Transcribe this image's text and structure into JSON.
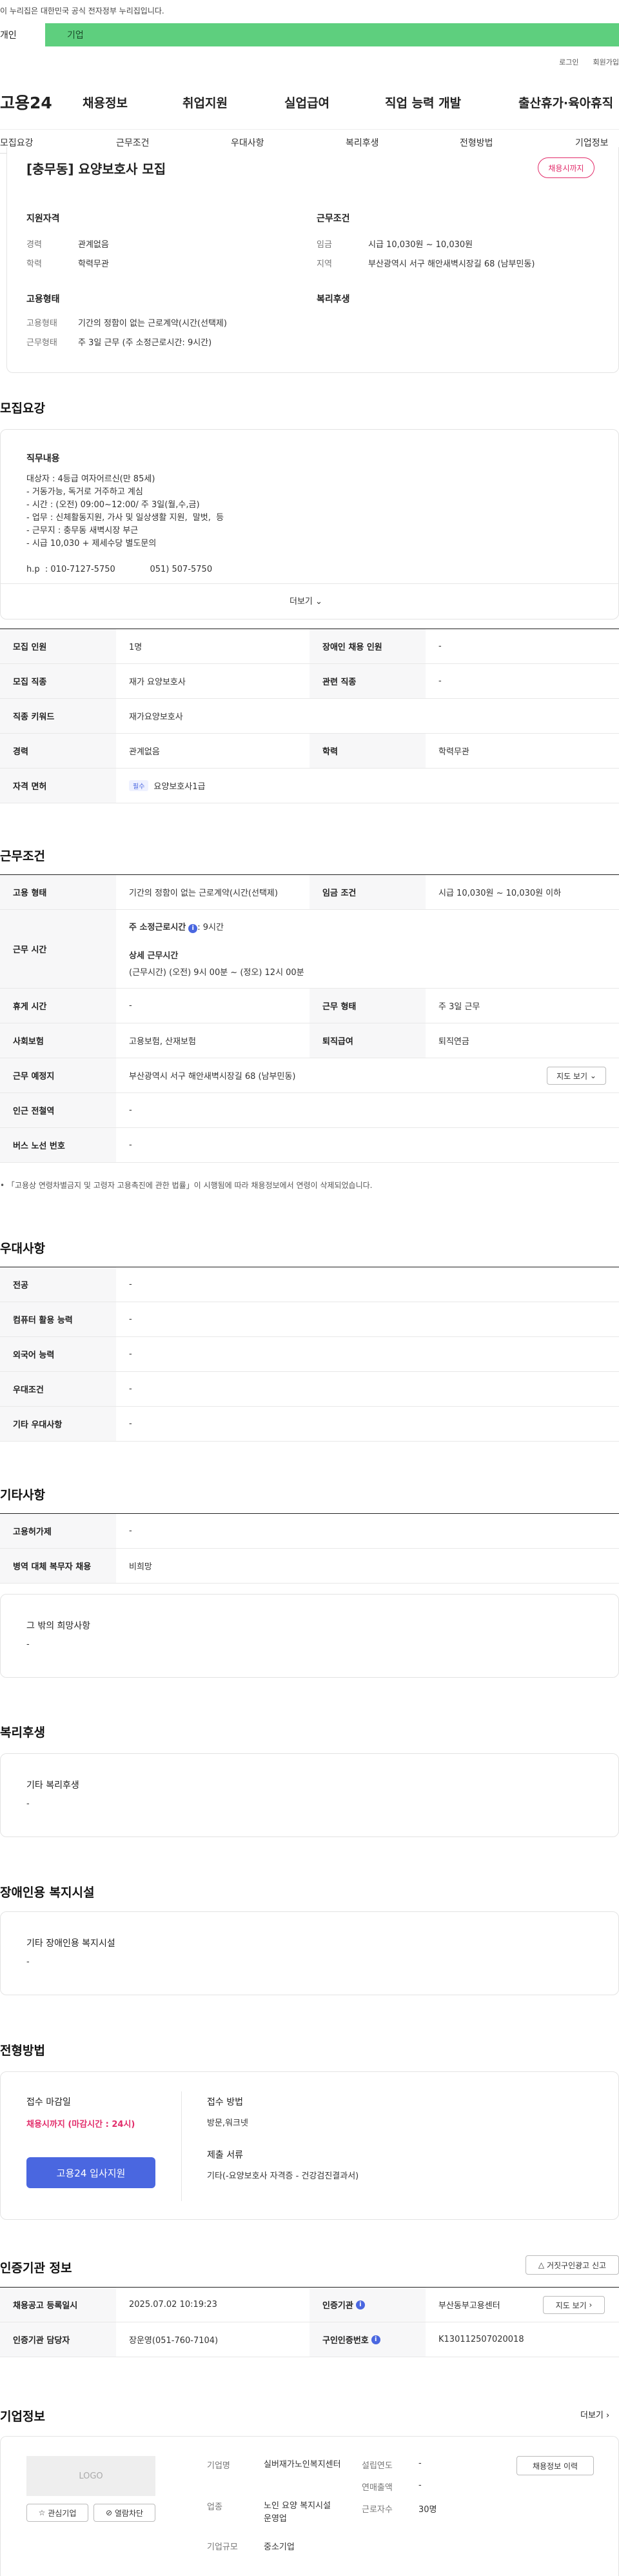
{
  "gov_banner": "이 누리집은 대한민국 공식 전자정부 누리집입니다.",
  "segments": [
    "개인",
    "기업"
  ],
  "util": [
    "로그인",
    "회원가입"
  ],
  "logo": "고용24",
  "gnb": [
    "채용정보",
    "취업지원",
    "실업급여",
    "직업 능력 개발",
    "출산휴가·육아휴직"
  ],
  "subnav": [
    "모집요강",
    "근무조건",
    "우대사항",
    "복리후생",
    "전형방법",
    "기업정보"
  ],
  "job": {
    "title": "[충무동] 요양보호사 모집",
    "badge": "채용시까지",
    "req_title": "지원자격",
    "career_label": "경력",
    "career": "관계없음",
    "edu_label": "학력",
    "edu": "학력무관",
    "cond_title": "근무조건",
    "wage_label": "임금",
    "wage": "시급 10,030원 ~ 10,030원",
    "area_label": "지역",
    "area": "부산광역시 서구 해안새벽시장길 68 (남부민동)",
    "form_title": "고용형태",
    "emp_label": "고용형태",
    "emp": "기간의 정함이 없는 근로계약(시간(선택제)",
    "work_label": "근무형태",
    "work": "주 3일 근무 (주 소정근로시간: 9시간)",
    "welfare_title": "복리후생"
  },
  "recruit": {
    "title": "모집요강",
    "duty_title": "직무내용",
    "duty_text": "대상자 : 4등급 여자어르신(만 85세)\n- 거동가능, 독거로 거주하고 계심\n- 시간 : (오전) 09:00~12:00/ 주 3일(월,수,금)\n- 업무 : 신체활동지원, 가사 및 일상생활 지원,  말벗,  등\n- 근무지 : 충무동 새벽시장 부근\n- 시급 10,030 + 제세수당 별도문의\n\nh.p  : 010-7127-5750             051) 507-5750",
    "more": "더보기",
    "rows": [
      {
        "l1": "모집 인원",
        "v1": "1명",
        "l2": "장애인 채용 인원",
        "v2": "-"
      },
      {
        "l1": "모집 직종",
        "v1": "재가 요양보호사",
        "l2": "관련 직종",
        "v2": "-"
      },
      {
        "l1": "직종 키워드",
        "v1": "재가요양보호사"
      },
      {
        "l1": "경력",
        "v1": "관계없음",
        "l2": "학력",
        "v2": "학력무관"
      },
      {
        "l1": "자격 면허",
        "tag": "필수",
        "v1": "요양보호사1급"
      }
    ]
  },
  "cond": {
    "title": "근무조건",
    "emp_l": "고용 형태",
    "emp_v": "기간의 정함이 없는 근로계약(시간(선택제)",
    "wage_l": "임금 조건",
    "wage_v": "시급 10,030원 ~ 10,030원 이하",
    "time_l": "근무 시간",
    "time_main": "주 소정근로시간",
    "time_main_v": ": 9시간",
    "time_detail": "상세 근무시간",
    "time_detail_v": "(근무시간) (오전) 9시 00분 ~ (정오) 12시 00분",
    "rest_l": "휴게 시간",
    "rest_v": "-",
    "type_l": "근무 형태",
    "type_v": "주 3일 근무",
    "ins_l": "사회보험",
    "ins_v": "고용보험, 산재보험",
    "sev_l": "퇴직급여",
    "sev_v": "퇴직연금",
    "place_l": "근무 예정지",
    "place_v": "부산광역시 서구 해안새벽시장길 68 (남부민동)",
    "map": "지도 보기",
    "sub_l": "인근 전철역",
    "sub_v": "-",
    "bus_l": "버스 노선 번호",
    "bus_v": "-",
    "notice": "「고용상 연령차별금지 및 고령자 고용촉진에 관한 법률」이 시행됨에 따라 채용정보에서 연령이 삭제되었습니다."
  },
  "pref": {
    "title": "우대사항",
    "rows": [
      {
        "l": "전공",
        "v": "-"
      },
      {
        "l": "컴퓨터 활용 능력",
        "v": "-"
      },
      {
        "l": "외국어 능력",
        "v": "-"
      },
      {
        "l": "우대조건",
        "v": "-"
      },
      {
        "l": "기타 우대사항",
        "v": "-"
      }
    ]
  },
  "etc": {
    "title": "기타사항",
    "rows": [
      {
        "l": "고용허가제",
        "v": "-"
      },
      {
        "l": "병역 대체 복무자 채용",
        "v": "비희망"
      }
    ],
    "box_title": "그 밖의 희망사항",
    "box_v": "-"
  },
  "welfare": {
    "title": "복리후생",
    "box_title": "기타 복리후생",
    "box_v": "-"
  },
  "disab": {
    "title": "장애인용 복지시설",
    "box_title": "기타 장애인용 복지시설",
    "box_v": "-"
  },
  "process": {
    "title": "전형방법",
    "deadline_l": "접수 마감일",
    "deadline_v": "채용시까지 (마감시간 : 24시)",
    "apply": "고용24 입사지원",
    "method_l": "접수 방법",
    "method_v": "방문,워크넷",
    "docs_l": "제출 서류",
    "docs_v": "기타(-요양보호사 자격증 - 건강검진결과서)"
  },
  "agency": {
    "title": "인증기관 정보",
    "report": "거짓구인광고 신고",
    "reg_l": "채용공고 등록일시",
    "reg_v": "2025.07.02 10:19:23",
    "org_l": "인증기관",
    "org_v": "부산동부고용센터",
    "map": "지도 보기",
    "mgr_l": "인증기관 담당자",
    "mgr_v": "장운영(051-760-7104)",
    "no_l": "구인인증번호",
    "no_v": "K130112507020018"
  },
  "company": {
    "title": "기업정보",
    "more": "더보기",
    "logo": "LOGO",
    "fav": "관심기업",
    "block": "열람차단",
    "name_l": "기업명",
    "name_v": "실버재가노인복지센터",
    "year_l": "설립연도",
    "year_v": "-",
    "jobs_btn": "채용정보 이력",
    "sales_l": "연매출액",
    "sales_v": "-",
    "ind_l": "업종",
    "ind_v": "노인 요양 복지시설 운영업",
    "emp_l": "근로자수",
    "emp_v": "30명",
    "size_l": "기업규모",
    "size_v": "중소기업"
  },
  "colors": {
    "green": "#5ecf7e",
    "blue": "#4a67e0",
    "pink": "#e22d6b"
  }
}
